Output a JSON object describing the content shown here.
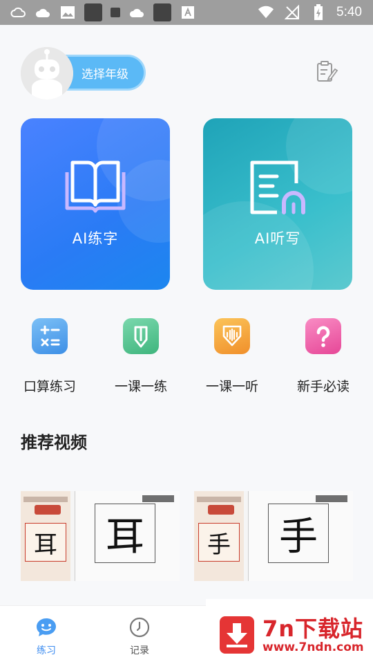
{
  "status_bar": {
    "time": "5:40",
    "left_icons": [
      "cloud-icon",
      "cloudy-icon",
      "image-icon",
      "app-square-icon",
      "small-square-icon",
      "cloud-icon",
      "app-square-icon",
      "font-icon"
    ],
    "right_icons": [
      "wifi-icon",
      "no-signal-icon",
      "battery-icon"
    ]
  },
  "header": {
    "grade_button": "选择年级",
    "edit_icon": "edit-note-icon"
  },
  "cards": [
    {
      "title": "AI练字",
      "icon": "book-icon",
      "color": "#2a7bf5"
    },
    {
      "title": "AI听写",
      "icon": "dictation-icon",
      "color": "#2fb3c3"
    }
  ],
  "shortcuts": [
    {
      "label": "口算练习",
      "icon": "calc-icon",
      "color": "#5aa7ee"
    },
    {
      "label": "一课一练",
      "icon": "pencil-icon",
      "color": "#55c28f"
    },
    {
      "label": "一课一听",
      "icon": "audio-download-icon",
      "color": "#f3a93a"
    },
    {
      "label": "新手必读",
      "icon": "question-icon",
      "color": "#ee5ca6"
    }
  ],
  "section": {
    "title": "推荐视频"
  },
  "videos": [
    {
      "char": "耳"
    },
    {
      "char": "手"
    }
  ],
  "bottom_nav": [
    {
      "label": "练习",
      "icon": "chat-face-icon",
      "active": true
    },
    {
      "label": "记录",
      "icon": "clock-icon",
      "active": false
    }
  ],
  "watermark": {
    "title": "7n下载站",
    "url": "www.7ndn.com"
  }
}
